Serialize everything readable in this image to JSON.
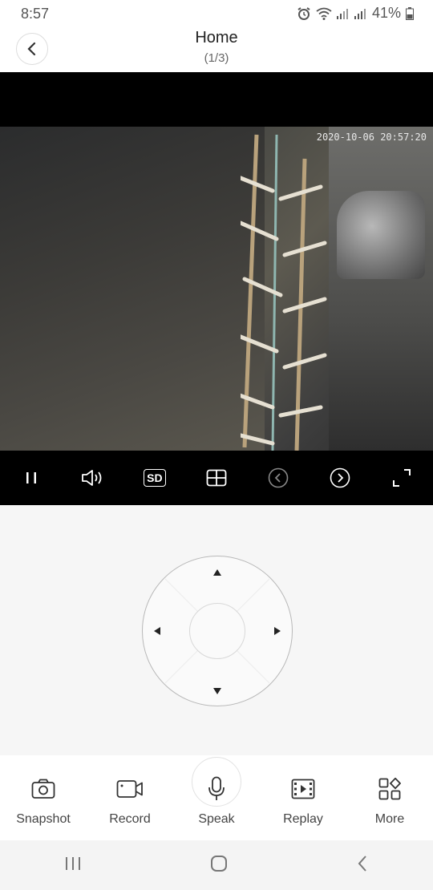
{
  "status_bar": {
    "time": "8:57",
    "battery": "41%"
  },
  "header": {
    "title": "Home",
    "subtitle": "(1/3)"
  },
  "video": {
    "timestamp": "2020-10-06 20:57:20"
  },
  "player_controls": {
    "sd_label": "SD"
  },
  "toolbar": {
    "snapshot": "Snapshot",
    "record": "Record",
    "speak": "Speak",
    "replay": "Replay",
    "more": "More"
  }
}
